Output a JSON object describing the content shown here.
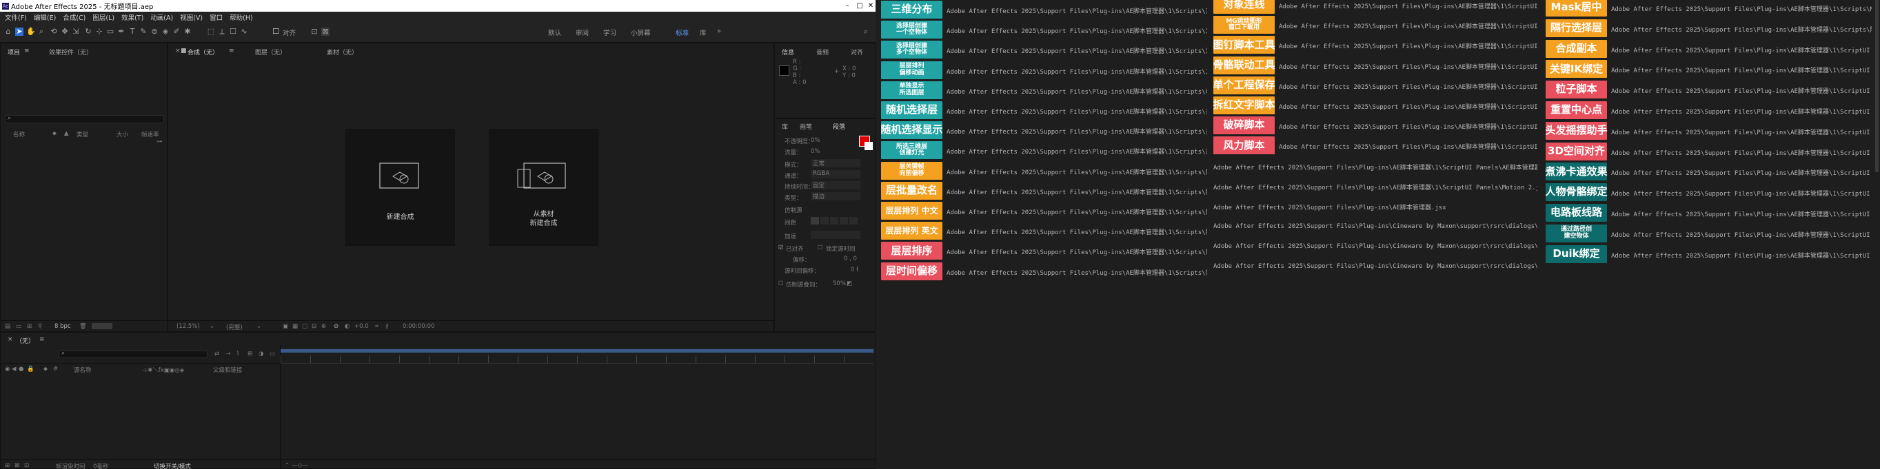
{
  "window": {
    "title": "Adobe After Effects 2025 - 无标题项目.aep",
    "minimize": "–",
    "maximize": "□",
    "close": "✕"
  },
  "menu": [
    "文件(F)",
    "编辑(E)",
    "合成(C)",
    "图层(L)",
    "效果(T)",
    "动画(A)",
    "视图(V)",
    "窗口",
    "帮助(H)"
  ],
  "toolbar": {
    "align_label": "对齐",
    "workspaces": [
      "默认",
      "审阅",
      "学习",
      "小屏幕",
      "标准",
      "库"
    ]
  },
  "project": {
    "tab": "项目",
    "tab_menu": "≡",
    "effects_tab": "效果控件（无）",
    "search_placeholder": "",
    "columns": [
      "名称",
      "类型",
      "大小",
      "帧速率"
    ],
    "bpc": "8 bpc"
  },
  "composition": {
    "tab": "合成（无）",
    "tab_menu": "≡",
    "layer_tab": "图层（无）",
    "footage_tab": "素材（无）",
    "new_comp": "新建合成",
    "from_footage_line1": "从素材",
    "from_footage_line2": "新建合成",
    "zoom": "(12.5%)",
    "quality": "(完整)",
    "exposure": "+0.0",
    "timecode": "0:00:00:00"
  },
  "info_panel": {
    "tabs": [
      "信息",
      "音频",
      "对齐"
    ],
    "values": [
      "R :",
      "G :",
      "B :",
      "A : 0"
    ],
    "xy": "X : 0\nY : 0"
  },
  "char_panel": {
    "tabs": [
      "库",
      "画笔",
      "段落",
      "字符"
    ],
    "rows": [
      "不透明度：",
      "流量：",
      "模式：",
      "通道：",
      "持续时间：",
      "类型："
    ],
    "values": [
      "0%",
      "0%",
      "正常",
      "RGBA",
      "固定",
      "描边"
    ],
    "duration": "加速",
    "spacing": "间距",
    "clone_source": "仿制源",
    "offset": "偏移：",
    "scale": "缩放：",
    "rotate": "旋转：",
    "frame_offset": "源时间偏移：",
    "lock_source": "锁定源时间",
    "show_overlay": "仿制源叠加：",
    "opacity": "50%",
    "checkbox1": "已对齐",
    "checkbox2": "锁定源时间"
  },
  "timeline": {
    "tab": "（无）",
    "tab_menu": "≡",
    "search_placeholder": "",
    "columns": [
      "源名称",
      "父级和链接"
    ],
    "footer_left": "帧渲染时间",
    "footer_time": "0毫秒",
    "footer_mode": "切换开关/模式"
  },
  "script_panel": {
    "col1": [
      {
        "label": "三维分布",
        "color": "teal",
        "path": "Adobe After Effects 2025\\Support Files\\Plug-ins\\AE脚本管理器\\1\\Scripts\\三维阵列分布.jsx"
      },
      {
        "label": "选择层创建\n一个空物体",
        "color": "teal",
        "path": "Adobe After Effects 2025\\Support Files\\Plug-ins\\AE脚本管理器\\1\\Scripts\\为选择的层创建"
      },
      {
        "label": "选择层创建\n多个空物体",
        "color": "teal",
        "path": "Adobe After Effects 2025\\Support Files\\Plug-ins\\AE脚本管理器\\1\\Scripts\\为选择的层创建"
      },
      {
        "label": "层层排列\n偏移动画",
        "color": "teal",
        "path": "Adobe After Effects 2025\\Support Files\\Plug-ins\\AE脚本管理器\\1\\Scripts\\二维三维阵列"
      },
      {
        "label": "单独显示\n所选图层",
        "color": "teal",
        "path": "Adobe After Effects 2025\\Support Files\\Plug-ins\\AE脚本管理器\\1\\Scripts\\单独面板显示"
      },
      {
        "label": "随机选择层",
        "color": "teal",
        "path": "Adobe After Effects 2025\\Support Files\\Plug-ins\\AE脚本管理器\\1\\Scripts\\多层随机选择"
      },
      {
        "label": "随机选择显示",
        "color": "teal",
        "path": "Adobe After Effects 2025\\Support Files\\Plug-ins\\AE脚本管理器\\1\\Scripts\\多层随机选择"
      },
      {
        "label": "所选三维层\n创建灯光",
        "color": "teal",
        "path": "Adobe After Effects 2025\\Support Files\\Plug-ins\\AE脚本管理器\\1\\Scripts\\对选定的三维"
      },
      {
        "label": "层关键帧\n向前偏移",
        "color": "orange",
        "path": "Adobe After Effects 2025\\Support Files\\Plug-ins\\AE脚本管理器\\1\\Scripts\\层位置偏移.jsx"
      },
      {
        "label": "层批量改名",
        "color": "orange",
        "path": "Adobe After Effects 2025\\Support Files\\Plug-ins\\AE脚本管理器\\1\\Scripts\\层批量改名.jsx"
      },
      {
        "label": "层层排列 中文",
        "color": "orange",
        "path": "Adobe After Effects 2025\\Support Files\\Plug-ins\\AE脚本管理器\\1\\Scripts\\层层排列中文.jsx"
      },
      {
        "label": "层层排列 英文",
        "color": "orange",
        "path": "Adobe After Effects 2025\\Support Files\\Plug-ins\\AE脚本管理器\\1\\Scripts\\层层排列英文.jsx"
      },
      {
        "label": "层层排序",
        "color": "red",
        "path": "Adobe After Effects 2025\\Support Files\\Plug-ins\\AE脚本管理器\\1\\Scripts\\层层排序.jsx"
      },
      {
        "label": "层时间偏移",
        "color": "red",
        "path": "Adobe After Effects 2025\\Support Files\\Plug-ins\\AE脚本管理器\\1\\Scripts\\层时间偏移 随"
      }
    ],
    "col2": [
      {
        "label": "对象连线",
        "color": "orange",
        "path": "Adobe After Effects 2025\\Support Files\\Plug-ins\\AE脚本管理器\\1\\ScriptUI Panels\\"
      },
      {
        "label": "MG运动图形\n窗口下载用",
        "color": "orange",
        "path": "Adobe After Effects 2025\\Support Files\\Plug-ins\\AE脚本管理器\\1\\ScriptUI Panels\\"
      },
      {
        "label": "图钉脚本工具",
        "color": "orange",
        "path": "Adobe After Effects 2025\\Support Files\\Plug-ins\\AE脚本管理器\\1\\ScriptUI Panels\\"
      },
      {
        "label": "骨骼联动工具",
        "color": "orange",
        "path": "Adobe After Effects 2025\\Support Files\\Plug-ins\\AE脚本管理器\\1\\ScriptUI Panels\\"
      },
      {
        "label": "单个工程保存",
        "color": "orange",
        "path": "Adobe After Effects 2025\\Support Files\\Plug-ins\\AE脚本管理器\\1\\ScriptUI Panels\\"
      },
      {
        "label": "拆红文字脚本",
        "color": "orange",
        "path": "Adobe After Effects 2025\\Support Files\\Plug-ins\\AE脚本管理器\\1\\ScriptUI Panels\\"
      },
      {
        "label": "破碎脚本",
        "color": "red",
        "path": "Adobe After Effects 2025\\Support Files\\Plug-ins\\AE脚本管理器\\1\\ScriptUI Panels\\"
      },
      {
        "label": "风力脚本",
        "color": "red",
        "path": "Adobe After Effects 2025\\Support Files\\Plug-ins\\AE脚本管理器\\1\\ScriptUI Panels\\"
      }
    ],
    "col2_long": [
      "Adobe After Effects 2025\\Support Files\\Plug-ins\\AE脚本管理器\\1\\ScriptUI Panels\\AE脚本管理器.jsx",
      "Adobe After Effects 2025\\Support Files\\Plug-ins\\AE脚本管理器\\1\\ScriptUI Panels\\Motion 2.jsxbin",
      "Adobe After Effects 2025\\Support Files\\Plug-ins\\AE脚本管理器.jsx",
      "Adobe After Effects 2025\\Support Files\\Plug-ins\\Cineware by Maxon\\support\\rsrc\\dialogs\\dlg_about.jsx",
      "Adobe After Effects 2025\\Support Files\\Plug-ins\\Cineware by Maxon\\support\\rsrc\\dialogs\\dlg_camera.jsx",
      "Adobe After Effects 2025\\Support Files\\Plug-ins\\Cineware by Maxon\\support\\rsrc\\dialogs\\dlg_layer.jsx"
    ],
    "col3": [
      {
        "label": "Mask居中",
        "color": "orange",
        "path": "Adobe After Effects 2025\\Support Files\\Plug-ins\\AE脚本管理器\\1\\Scripts\\Mask居中.jsx"
      },
      {
        "label": "隔行选择层",
        "color": "orange",
        "path": "Adobe After Effects 2025\\Support Files\\Plug-ins\\AE脚本管理器\\1\\Scripts\\隔行选择层"
      },
      {
        "label": "合成副本",
        "color": "orange",
        "path": "Adobe After Effects 2025\\Support Files\\Plug-ins\\AE脚本管理器\\1\\ScriptUI Panels\\"
      },
      {
        "label": "关键IK绑定",
        "color": "orange",
        "path": "Adobe After Effects 2025\\Support Files\\Plug-ins\\AE脚本管理器\\1\\ScriptUI Panels\\"
      },
      {
        "label": "粒子脚本",
        "color": "red",
        "path": "Adobe After Effects 2025\\Support Files\\Plug-ins\\AE脚本管理器\\1\\ScriptUI Panels\\"
      },
      {
        "label": "重置中心点",
        "color": "red",
        "path": "Adobe After Effects 2025\\Support Files\\Plug-ins\\AE脚本管理器\\1\\ScriptUI Panels\\"
      },
      {
        "label": "头发摇摆助手",
        "color": "red",
        "path": "Adobe After Effects 2025\\Support Files\\Plug-ins\\AE脚本管理器\\1\\ScriptUI Panels\\"
      },
      {
        "label": "3D空间对齐",
        "color": "red",
        "path": "Adobe After Effects 2025\\Support Files\\Plug-ins\\AE脚本管理器\\1\\ScriptUI Panels\\"
      },
      {
        "label": "煮沸卡通效果",
        "color": "dteal",
        "path": "Adobe After Effects 2025\\Support Files\\Plug-ins\\AE脚本管理器\\1\\ScriptUI Panels\\"
      },
      {
        "label": "人物骨骼绑定",
        "color": "dteal",
        "path": "Adobe After Effects 2025\\Support Files\\Plug-ins\\AE脚本管理器\\1\\ScriptUI Panels\\"
      },
      {
        "label": "电路板线路",
        "color": "dteal",
        "path": "Adobe After Effects 2025\\Support Files\\Plug-ins\\AE脚本管理器\\1\\ScriptUI Panels\\"
      },
      {
        "label": "通过路径创\n建空物体",
        "color": "dteal",
        "path": "Adobe After Effects 2025\\Support Files\\Plug-ins\\AE脚本管理器\\1\\ScriptUI Panels\\"
      },
      {
        "label": "Duik绑定",
        "color": "dteal",
        "path": "Adobe After Effects 2025\\Support Files\\Plug-ins\\AE脚本管理器\\1\\ScriptUI Panels\\"
      }
    ]
  }
}
